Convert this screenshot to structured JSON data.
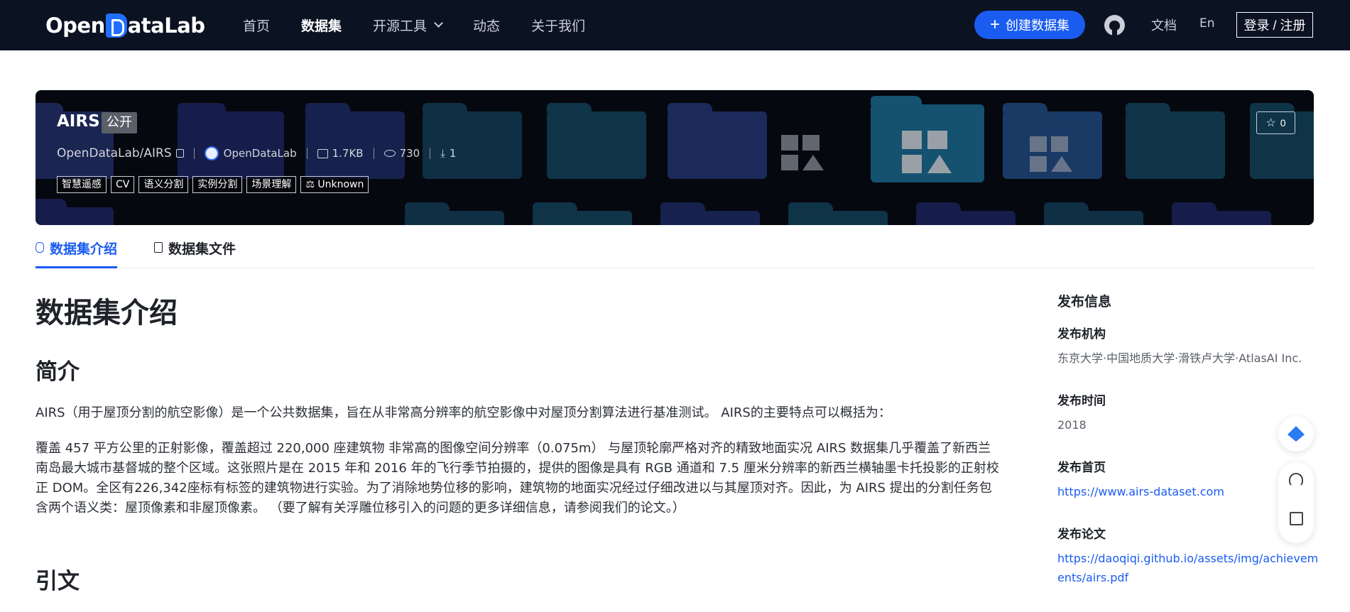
{
  "nav": {
    "logo_text_1": "Open",
    "logo_text_2": "ataLab",
    "menu": [
      {
        "label": "首页"
      },
      {
        "label": "数据集"
      },
      {
        "label": "开源工具"
      },
      {
        "label": "动态"
      },
      {
        "label": "关于我们"
      }
    ],
    "create_label": "创建数据集",
    "doc_label": "文档",
    "lang_label": "En",
    "login_label": "登录 / 注册"
  },
  "banner": {
    "title": "AIRS",
    "visibility": "公开",
    "repo": "OpenDataLab/AIRS",
    "org": "OpenDataLab",
    "size": "1.7KB",
    "views": "730",
    "downloads": "1",
    "tags": [
      "智慧遥感",
      "CV",
      "语义分割",
      "实例分割",
      "场景理解",
      "Unknown"
    ],
    "star_count": "0"
  },
  "tabs": [
    {
      "label": "数据集介绍"
    },
    {
      "label": "数据集文件"
    }
  ],
  "main": {
    "heading": "数据集介绍",
    "section1": "简介",
    "para1": "AIRS（用于屋顶分割的航空影像）是一个公共数据集，旨在从非常高分辨率的航空影像中对屋顶分割算法进行基准测试。 AIRS的主要特点可以概括为：",
    "para2": "覆盖 457 平方公里的正射影像，覆盖超过 220,000 座建筑物 非常高的图像空间分辨率（0.075m） 与屋顶轮廓严格对齐的精致地面实况 AIRS 数据集几乎覆盖了新西兰南岛最大城市基督城的整个区域。这张照片是在 2015 年和 2016 年的飞行季节拍摄的，提供的图像是具有 RGB 通道和 7.5 厘米分辨率的新西兰横轴墨卡托投影的正射校正 DOM。全区有226,342座标有标签的建筑物进行实验。为了消除地势位移的影响，建筑物的地面实况经过仔细改进以与其屋顶对齐。因此，为 AIRS 提出的分割任务包含两个语义类：屋顶像素和非屋顶像素。 （要了解有关浮雕位移引入的问题的更多详细信息，请参阅我们的论文。）",
    "section2": "引文"
  },
  "sidebar": {
    "title": "发布信息",
    "org_label": "发布机构",
    "org_value": "东京大学·中国地质大学·滑铁卢大学·AtlasAI Inc.",
    "time_label": "发布时间",
    "time_value": "2018",
    "home_label": "发布首页",
    "home_value": "https://www.airs-dataset.com",
    "paper_label": "发布论文",
    "paper_value": "https://daoqiqi.github.io/assets/img/achievements/airs.pdf"
  },
  "colors": {
    "nav_bg": "#0b1222",
    "accent": "#1a5cf0",
    "banner_bg": "#06080f"
  },
  "icons": {
    "logo": "opendatalab-logo",
    "github": "github-icon",
    "star": "star-icon",
    "copy": "copy-icon",
    "size": "hdd-icon",
    "views": "eye-icon",
    "downloads": "download-icon",
    "license": "scale-icon",
    "float1": "diamond-logo-icon",
    "float2a": "headset-icon",
    "float2b": "edit-icon"
  }
}
